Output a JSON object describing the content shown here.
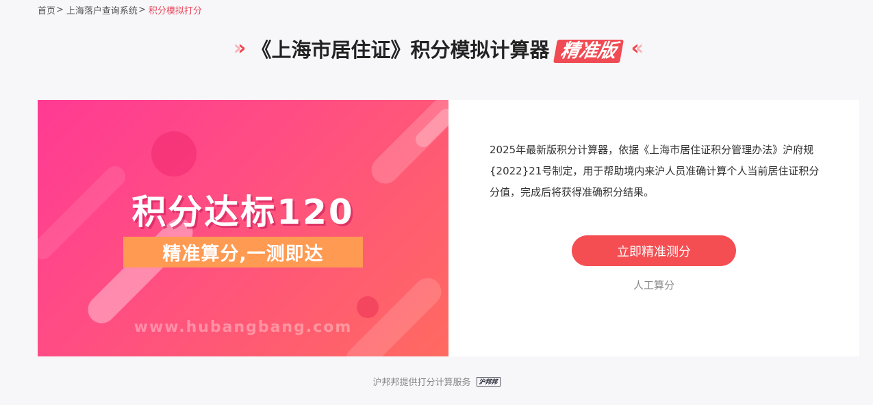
{
  "breadcrumb": {
    "items": [
      "首页",
      "上海落户查询系统",
      "积分模拟打分"
    ],
    "separator": ">"
  },
  "header": {
    "title": "《上海市居住证》积分模拟计算器",
    "badge": "精准版"
  },
  "banner": {
    "headline": "积分达标120",
    "subline": "精准算分,一测即达",
    "watermark": "www.hubangbang.com"
  },
  "info": {
    "description": "2025年最新版积分计算器，依据《上海市居住证积分管理办法》沪府规{2022}21号制定，用于帮助境内来沪人员准确计算个人当前居住证积分分值，完成后将获得准确积分结果。",
    "primary_button": "立即精准测分",
    "secondary_link": "人工算分"
  },
  "footer": {
    "text": "沪邦邦提供打分计算服务",
    "logo_text": "沪邦邦"
  },
  "colors": {
    "accent": "#f44e52",
    "breadcrumb_current": "#e8455a",
    "banner_orange": "#ff9a52"
  }
}
